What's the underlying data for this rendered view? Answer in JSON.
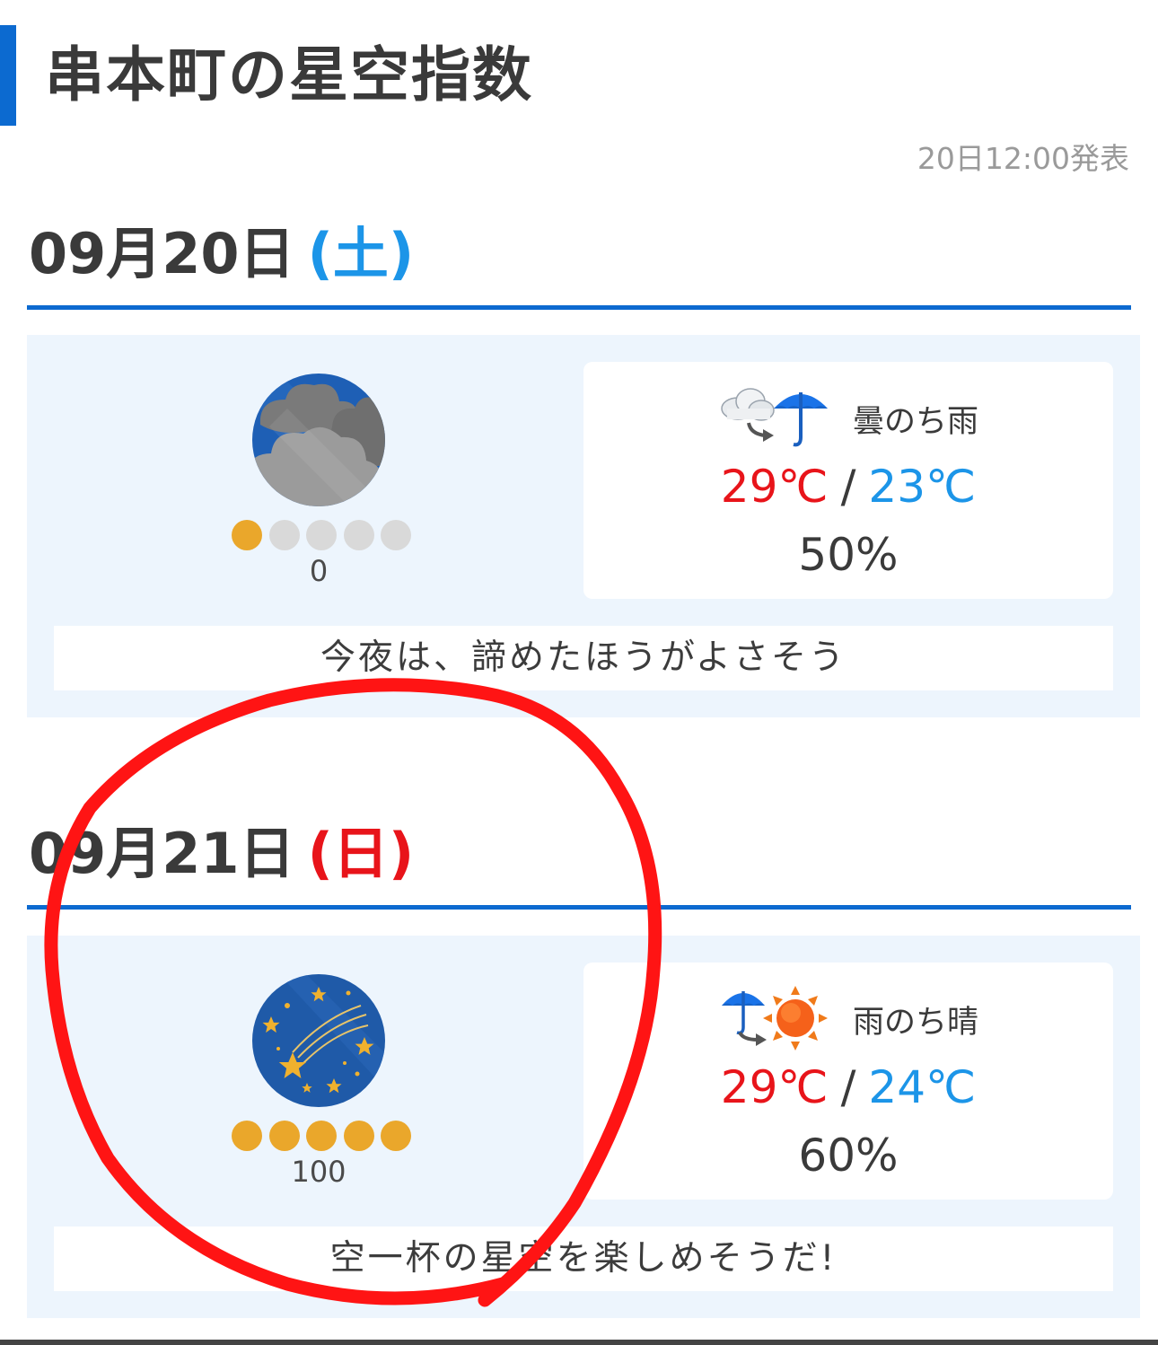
{
  "page": {
    "title": "串本町の星空指数",
    "published": "20日12:00発表"
  },
  "colors": {
    "accent_blue": "#0c6ad0",
    "saturday": "#1c95e8",
    "sunday": "#e8141a",
    "temp_high": "#e8141a",
    "temp_low": "#1c95e8",
    "index_dot_on": "#eaa72b",
    "index_dot_off": "#d9d9d9",
    "card_bg": "#edf5fd",
    "annotation_red": "#ff0000"
  },
  "days": [
    {
      "date": "09月20日",
      "dow": "(土)",
      "sky_icon": "cloudy-sky-icon",
      "index_level": 1,
      "index_max": 5,
      "score": "0",
      "weather_icon": "cloudy-then-rain-icon",
      "weather": "曇のち雨",
      "temp_high": "29℃",
      "temp_low": "23℃",
      "temp_sep": "/",
      "precip": "50%",
      "comment": "今夜は、諦めたほうがよさそう"
    },
    {
      "date": "09月21日",
      "dow": "(日)",
      "sky_icon": "starry-sky-icon",
      "index_level": 5,
      "index_max": 5,
      "score": "100",
      "weather_icon": "rain-then-sunny-icon",
      "weather": "雨のち晴",
      "temp_high": "29℃",
      "temp_low": "24℃",
      "temp_sep": "/",
      "precip": "60%",
      "comment": "空一杯の星空を楽しめそうだ!"
    }
  ]
}
